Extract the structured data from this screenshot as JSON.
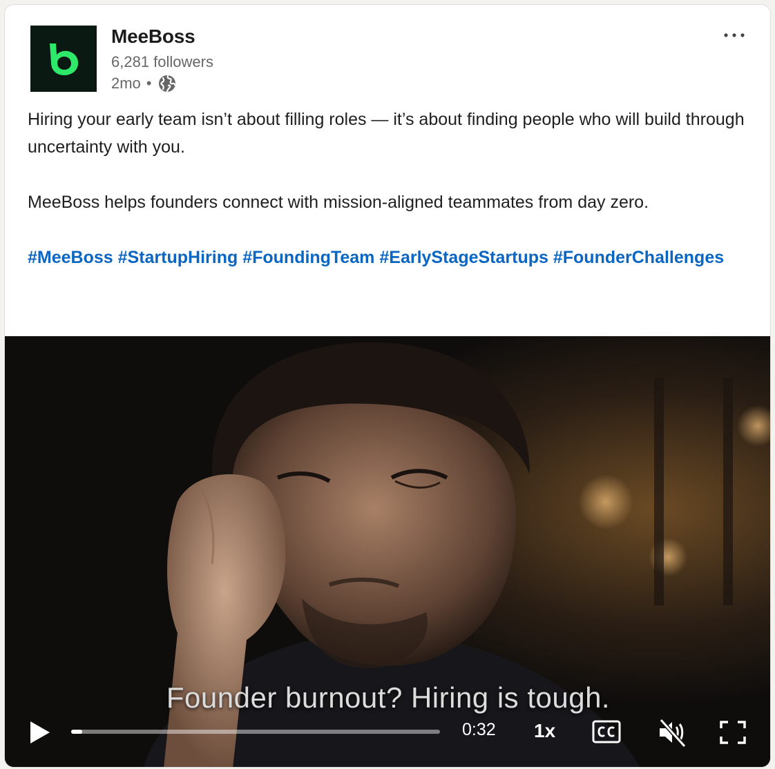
{
  "post": {
    "author": "MeeBoss",
    "followers": "6,281 followers",
    "time": "2mo",
    "separator": "•",
    "logo_letter": "b",
    "logo_bg": "#0a1a12",
    "logo_color": "#2ee86a"
  },
  "content": {
    "paragraph1": "Hiring your early team isn’t about filling roles — it’s about finding people who will build through uncertainty with you.",
    "paragraph2": "MeeBoss helps founders connect with mission-aligned teammates from day zero.",
    "hashtags": [
      "#MeeBoss",
      "#StartupHiring",
      "#FoundingTeam",
      "#EarlyStageStartups",
      "#FounderChallenges"
    ],
    "link_color": "#0a66c2"
  },
  "video": {
    "subtitle": "Founder burnout? Hiring is tough.",
    "time": "0:32",
    "speed": "1x",
    "progress": 0.03,
    "captions_icon": "cc-icon",
    "muted": true
  },
  "icons": {
    "more": "more-options-icon",
    "globe": "globe-icon",
    "play": "play-icon",
    "mute": "muted-speaker-icon",
    "fullscreen": "fullscreen-icon"
  }
}
